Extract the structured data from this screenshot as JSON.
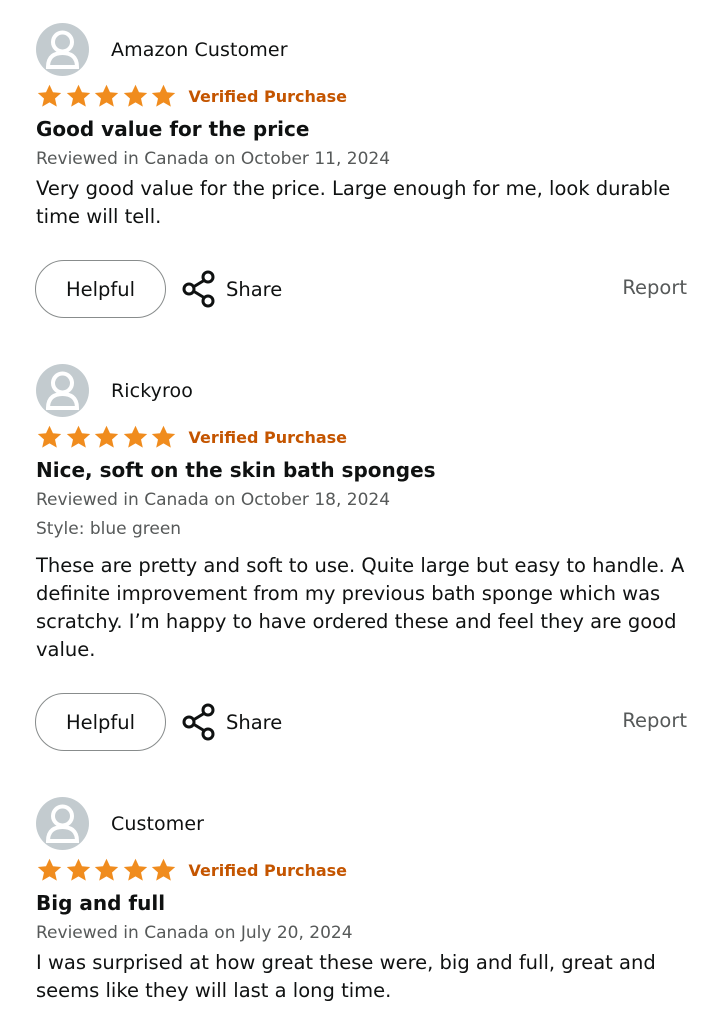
{
  "reviews": [
    {
      "reviewer": "Amazon Customer",
      "rating": 5,
      "verified": "Verified Purchase",
      "title": "Good value for the price",
      "date": "Reviewed in Canada on October 11, 2024",
      "style": "",
      "body": "Very good value for the price. Large enough for me, look durable time will tell.",
      "helpful_label": "Helpful",
      "share_label": "Share",
      "report_label": "Report"
    },
    {
      "reviewer": "Rickyroo",
      "rating": 5,
      "verified": "Verified Purchase",
      "title": "Nice, soft on the skin bath sponges",
      "date": "Reviewed in Canada on October 18, 2024",
      "style": "Style: blue green",
      "body": "These are pretty and soft to use. Quite large but easy to handle. A definite improvement from my previous bath sponge which was scratchy. I’m happy to have ordered these and feel they are good value.",
      "helpful_label": "Helpful",
      "share_label": "Share",
      "report_label": "Report"
    },
    {
      "reviewer": "Customer",
      "rating": 5,
      "verified": "Verified Purchase",
      "title": "Big and full",
      "date": "Reviewed in Canada on July 20, 2024",
      "style": "",
      "body": "I was surprised at how great these were, big and full, great and seems like they will last a long time."
    }
  ],
  "colors": {
    "star": "#f08c1e",
    "verified": "#c45500",
    "avatar_bg": "#c3cbcf",
    "avatar_fg": "#ffffff",
    "muted_text": "#565959"
  },
  "icons": {
    "avatar": "person-silhouette-icon",
    "star": "star-icon",
    "share": "share-icon"
  }
}
